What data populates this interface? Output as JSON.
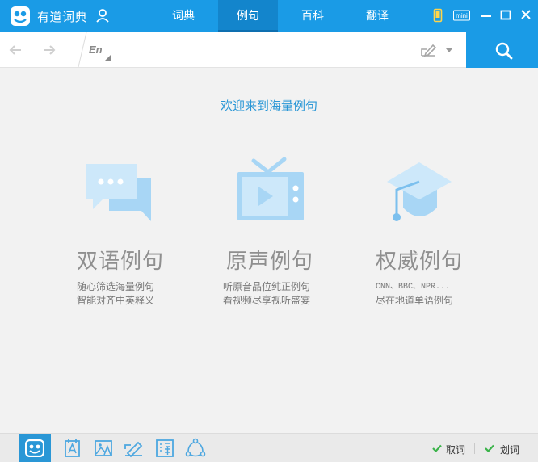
{
  "app": {
    "title": "有道词典"
  },
  "tabs": [
    {
      "label": "词典",
      "active": false
    },
    {
      "label": "例句",
      "active": true
    },
    {
      "label": "百科",
      "active": false
    },
    {
      "label": "翻译",
      "active": false
    }
  ],
  "window_controls": {
    "mini_label": "mini"
  },
  "search": {
    "lang_label": "En",
    "value": "",
    "placeholder": ""
  },
  "welcome": "欢迎来到海量例句",
  "features": [
    {
      "title": "双语例句",
      "desc1": "随心筛选海量例句",
      "desc2": "智能对齐中英释义",
      "icon": "chat-bubbles-icon"
    },
    {
      "title": "原声例句",
      "desc1": "听原音品位纯正例句",
      "desc2": "看视频尽享视听盛宴",
      "icon": "tv-icon"
    },
    {
      "title": "权威例句",
      "desc1": "CNN、BBC、NPR...",
      "desc2": "尽在地道单语例句",
      "icon": "graduation-cap-icon"
    }
  ],
  "bottom": {
    "quci_label": "取词",
    "huaci_label": "划词"
  },
  "colors": {
    "brand": "#1a9be6",
    "icon_light": "#a8d6f5",
    "icon_mid": "#7cc0ee"
  }
}
